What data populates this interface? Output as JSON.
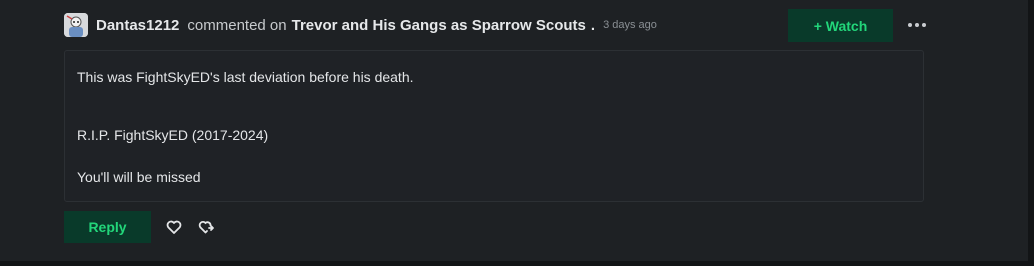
{
  "comment": {
    "author": "Dantas1212",
    "verb": "commented on",
    "deviation_title": "Trevor and His Gangs as Sparrow Scouts",
    "separator": ".",
    "timestamp": "3 days ago",
    "paragraphs": [
      "This was FightSkyED's last deviation before his death.",
      "R.I.P. FightSkyED (2017-2024)",
      "You'll will be missed"
    ]
  },
  "actions": {
    "watch_label": "+ Watch",
    "reply_label": "Reply"
  },
  "icons": {
    "avatar": "user-avatar",
    "more": "more-horizontal-icon",
    "like": "heart-icon",
    "share": "share-icon"
  },
  "colors": {
    "background": "#1e2124",
    "accent_green": "#22d67a",
    "button_bg": "#093a2a",
    "text": "#e4e6e8",
    "muted": "#8a8f94"
  }
}
